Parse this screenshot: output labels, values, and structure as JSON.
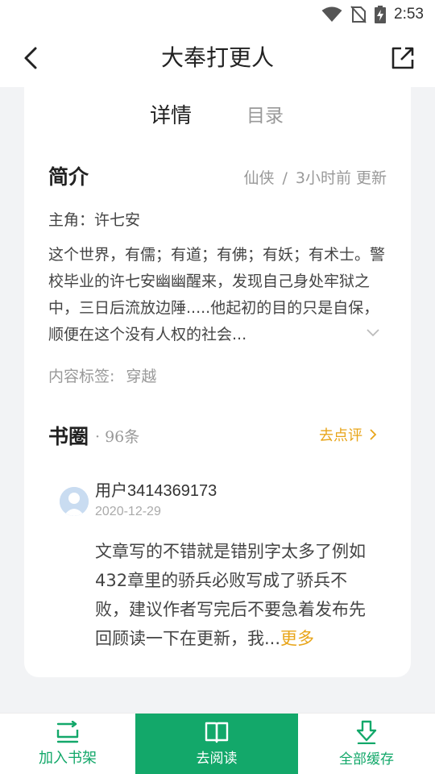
{
  "status_bar": {
    "time": "2:53"
  },
  "header": {
    "title": "大奉打更人"
  },
  "tabs": [
    {
      "label": "详情"
    },
    {
      "label": "目录"
    }
  ],
  "intro": {
    "title": "简介",
    "genre": "仙侠",
    "separator": "/",
    "updated": "3小时前 更新",
    "protagonist": "主角：许七安",
    "synopsis": "这个世界，有儒；有道；有佛；有妖；有术士。警校毕业的许七安幽幽醒来，发现自己身处牢狱之中，三日后流放边陲.....他起初的目的只是自保，顺便在这个没有人权的社会...",
    "tags_label": "内容标签:",
    "tags_value": "穿越"
  },
  "book_circle": {
    "title": "书圈",
    "count": "· 96条",
    "review_link": "去点评"
  },
  "comment": {
    "username": "用户3414369173",
    "date": "2020-12-29",
    "text": "文章写的不错就是错别字太多了例如432章里的骄兵必败写成了骄兵不败，建议作者写完后不要急着发布先回顾读一下在更新，我...",
    "more": "更多"
  },
  "bottom_bar": {
    "add_to_shelf": "加入书架",
    "read": "去阅读",
    "cache_all": "全部缓存"
  },
  "colors": {
    "accent_green": "#13a86a",
    "accent_orange": "#e8a51a"
  }
}
